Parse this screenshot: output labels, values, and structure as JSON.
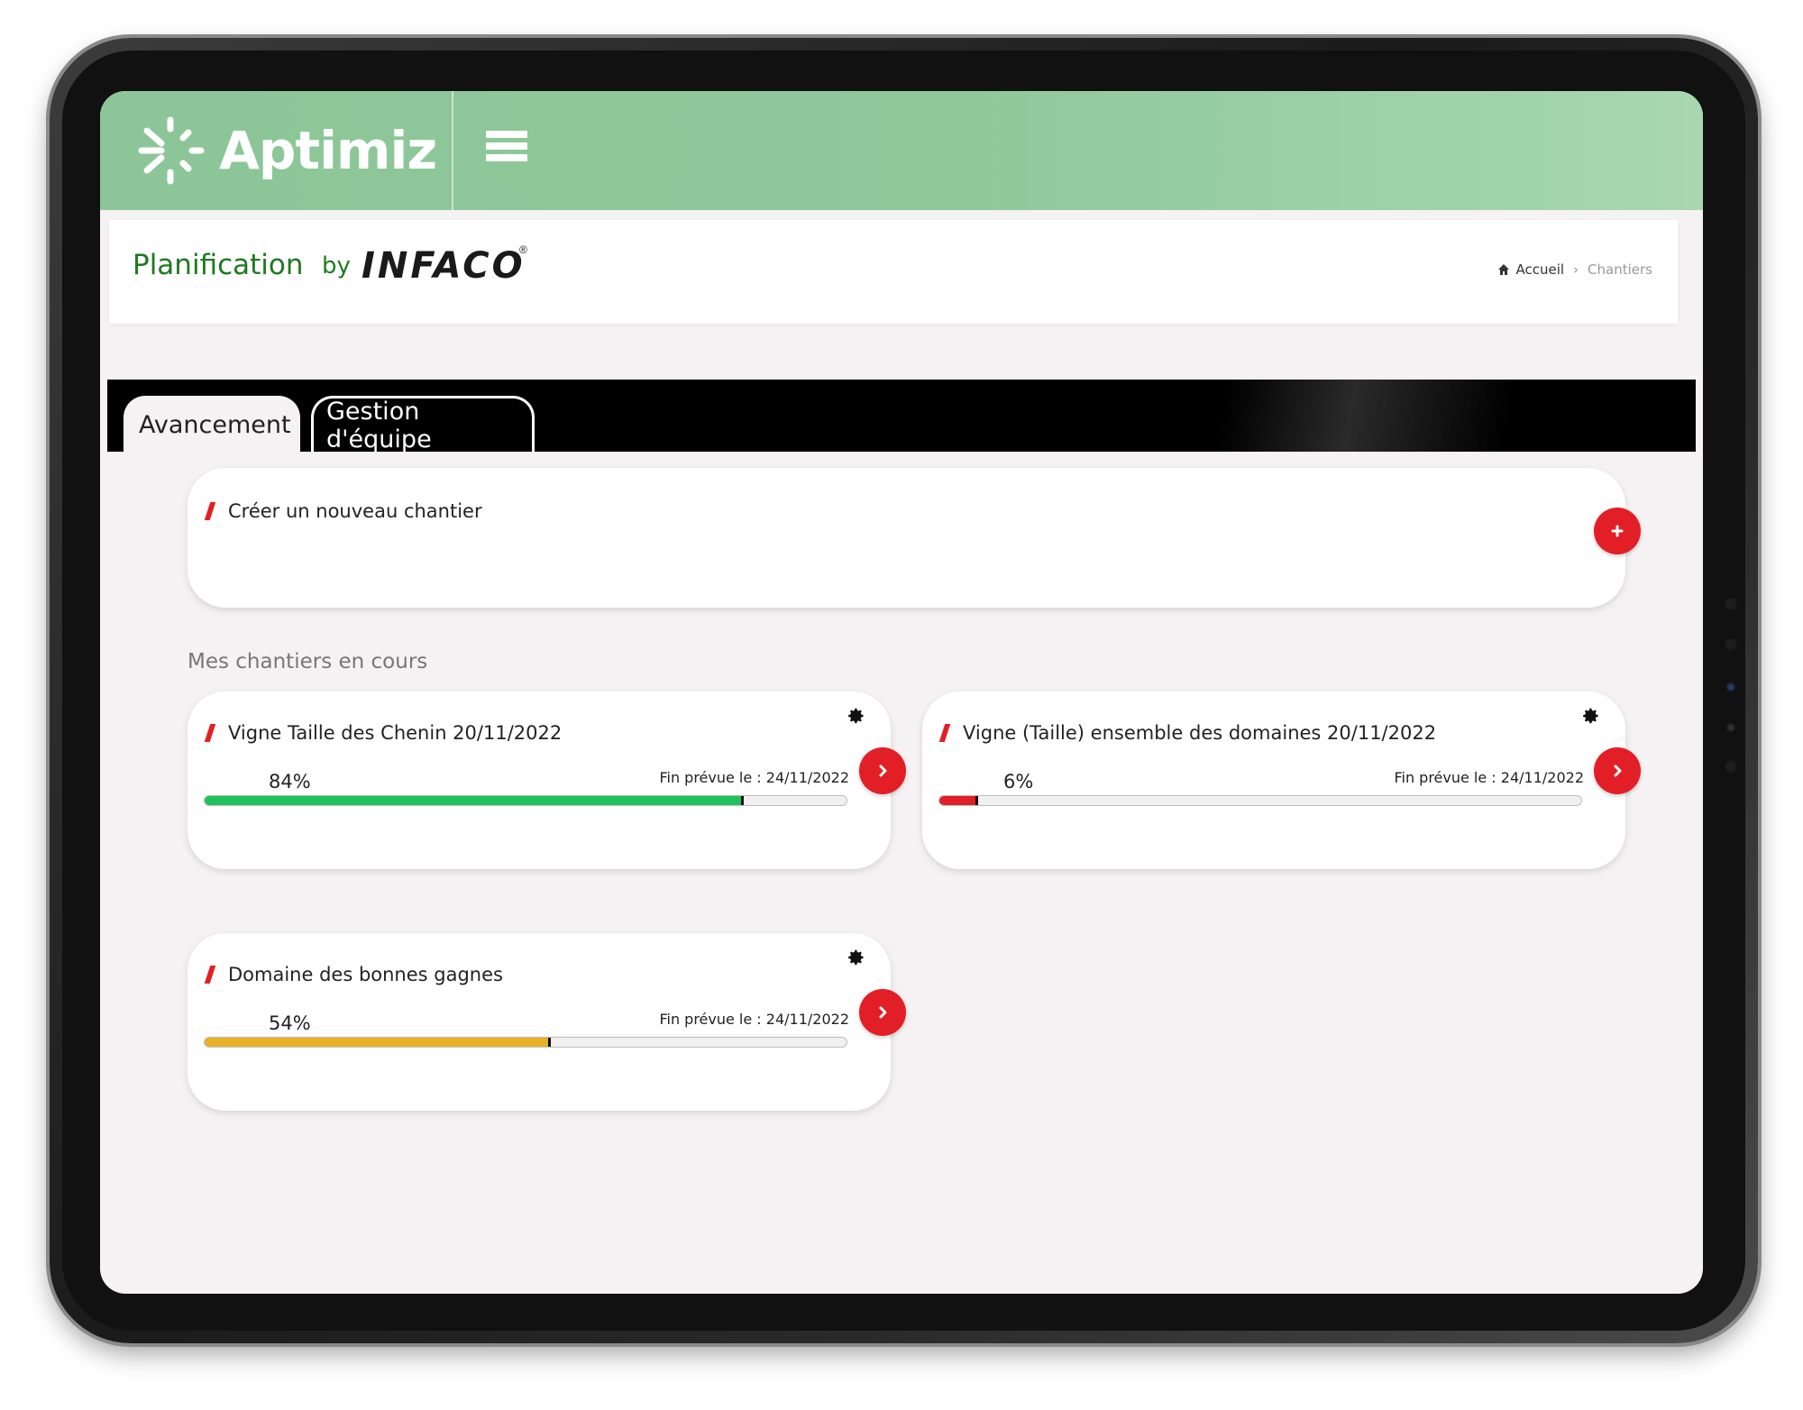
{
  "brand": {
    "name": "Aptimiz"
  },
  "header": {
    "title": "Planification",
    "by": "by",
    "company": "INFACO",
    "registered": "®"
  },
  "breadcrumb": {
    "home": "Accueil",
    "separator": "›",
    "current": "Chantiers"
  },
  "tabs": [
    {
      "label": "Avancement",
      "active": true
    },
    {
      "label": "Gestion d'équipe",
      "active": false
    }
  ],
  "create": {
    "label": "Créer un nouveau chantier",
    "button_icon": "plus-icon"
  },
  "section_title": "Mes chantiers en cours",
  "projects": [
    {
      "title": "Vigne Taille des Chenin 20/11/2022",
      "progress_label": "84%",
      "progress": 0.84,
      "due": "Fin prévue le : 24/11/2022",
      "bar_color": "#1fc25a"
    },
    {
      "title": "Vigne (Taille) ensemble des domaines 20/11/2022",
      "progress_label": "6%",
      "progress": 0.06,
      "due": "Fin prévue le : 24/11/2022",
      "bar_color": "#e21f26"
    },
    {
      "title": "Domaine des bonnes gagnes",
      "progress_label": "54%",
      "progress": 0.54,
      "due": "Fin prévue le : 24/11/2022",
      "bar_color": "#e8b12a"
    }
  ],
  "colors": {
    "topbar": "#8fc99a",
    "accent_red": "#e21f26",
    "title_green": "#1f7a22"
  }
}
